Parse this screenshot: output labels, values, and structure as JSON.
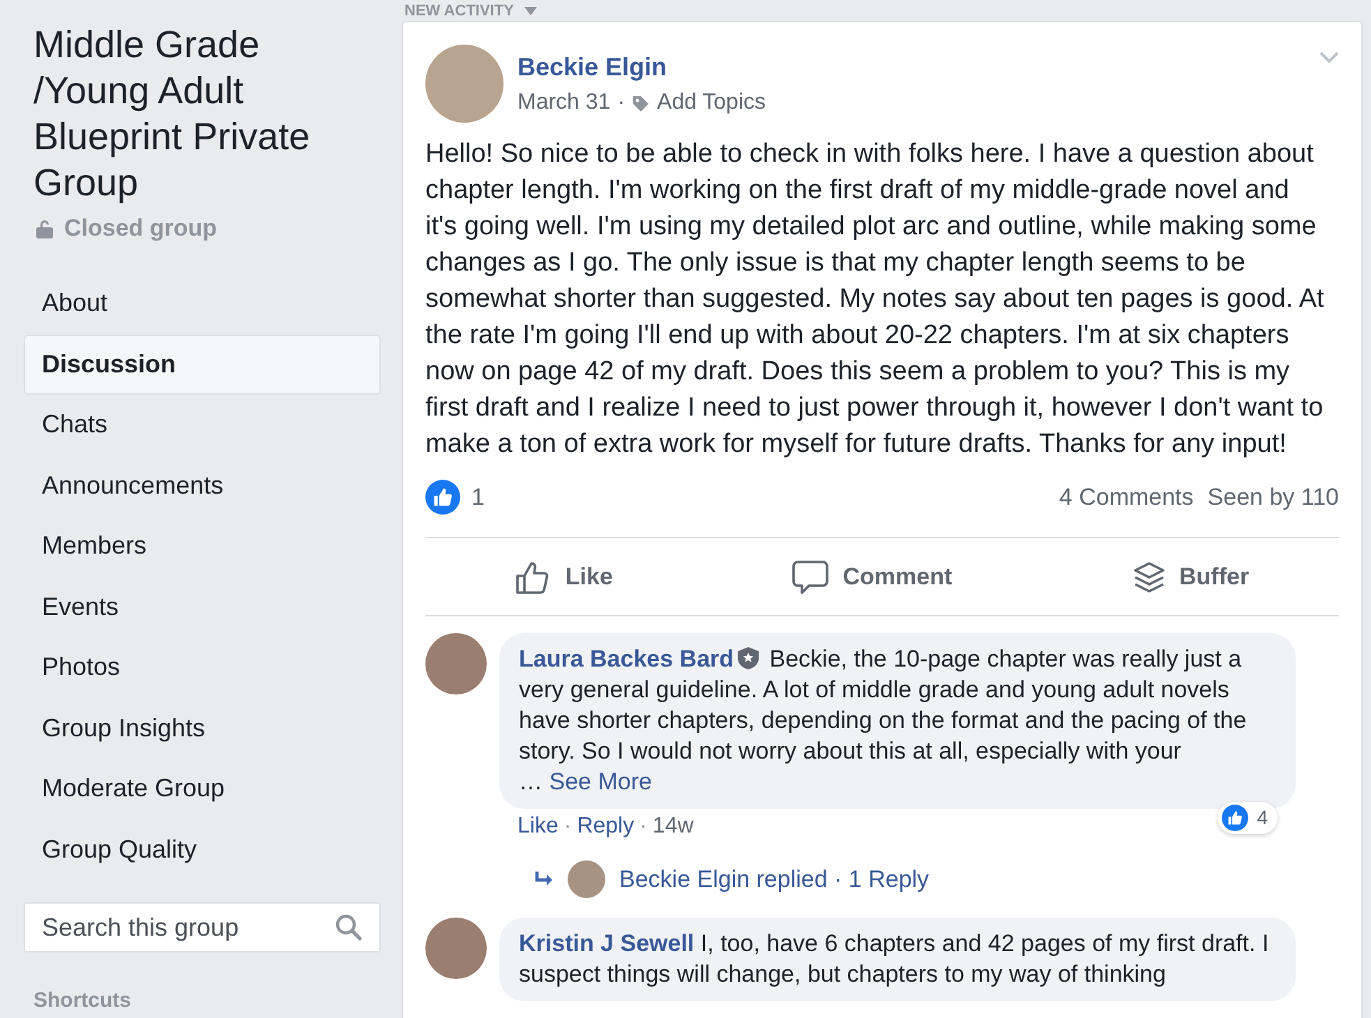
{
  "sidebar": {
    "group_title": "Middle Grade /Young Adult Blueprint Private Group",
    "privacy": "Closed group",
    "nav": [
      {
        "label": "About",
        "selected": false
      },
      {
        "label": "Discussion",
        "selected": true
      },
      {
        "label": "Chats",
        "selected": false
      },
      {
        "label": "Announcements",
        "selected": false
      },
      {
        "label": "Members",
        "selected": false
      },
      {
        "label": "Events",
        "selected": false
      },
      {
        "label": "Photos",
        "selected": false
      },
      {
        "label": "Group Insights",
        "selected": false
      },
      {
        "label": "Moderate Group",
        "selected": false
      },
      {
        "label": "Group Quality",
        "selected": false
      }
    ],
    "search": {
      "placeholder": "Search this group"
    },
    "shortcuts_heading": "Shortcuts"
  },
  "feed": {
    "section_label": "NEW ACTIVITY",
    "post": {
      "author": "Beckie Elgin",
      "date": "March 31",
      "separator": "·",
      "add_topics": "Add Topics",
      "body": "Hello! So nice to be able to check in with folks here. I have a question about chapter length. I'm working on the first draft of my middle-grade novel and it's going well. I'm using my detailed plot arc and outline, while making some changes as I go. The only issue is that my chapter length seems to be somewhat shorter than suggested. My notes say about ten pages is good. At the rate I'm going I'll end up with about 20-22 chapters. I'm at six chapters now on page 42 of my draft. Does this seem a problem to you? This is my first draft and I realize I need to just power through it, however I don't want to make a ton of extra work for myself for future drafts. Thanks for any input!",
      "reaction_count": "1",
      "comments_count": "4 Comments",
      "seen_by": "Seen by 110",
      "actions": [
        {
          "kind": "like",
          "label": "Like"
        },
        {
          "kind": "comment",
          "label": "Comment"
        },
        {
          "kind": "buffer",
          "label": "Buffer"
        }
      ]
    },
    "comments": [
      {
        "author": "Laura Backes Bard",
        "admin_badge": true,
        "text": "Beckie, the 10-page chapter was really just a very general guideline. A lot of middle grade and young adult novels have shorter chapters, depending on the format and the pacing of the story. So I would not worry about this at all, especially with your",
        "ellipsis": "…",
        "see_more": "See More",
        "reaction_count": "4",
        "like": "Like",
        "separator_1": "·",
        "reply": "Reply",
        "separator_2": "·",
        "time": "14w",
        "replies": "Beckie Elgin replied · 1 Reply"
      },
      {
        "author": "Kristin J Sewell",
        "admin_badge": false,
        "text": "I, too, have 6 chapters and 42 pages of my first draft. I suspect things will change, but chapters to my way of thinking"
      }
    ]
  }
}
